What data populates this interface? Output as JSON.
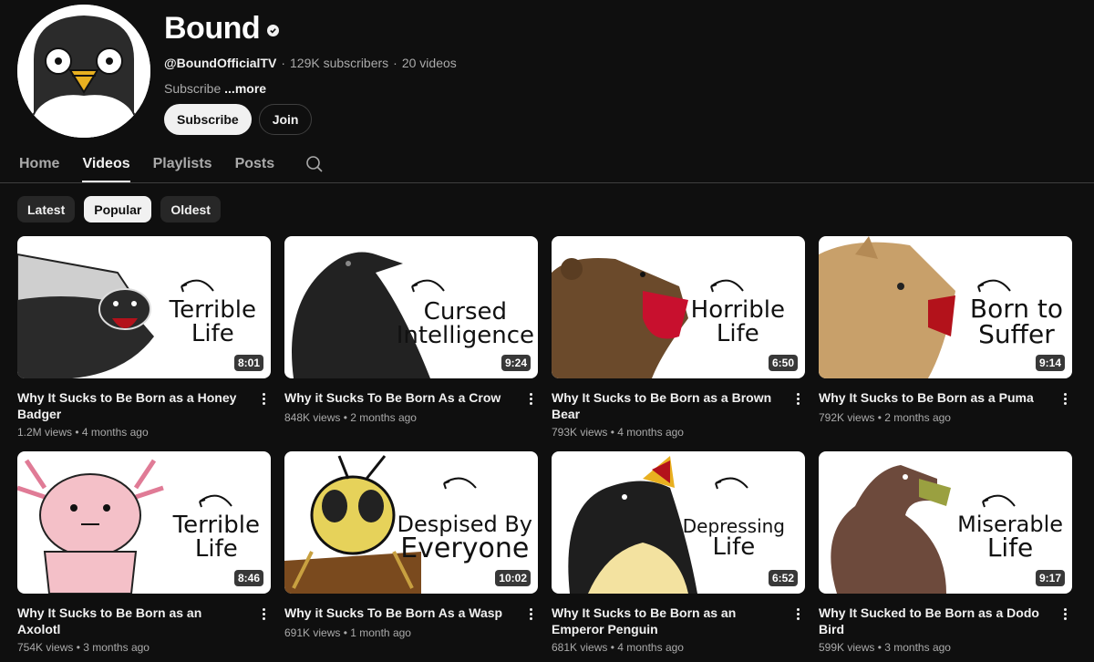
{
  "channel": {
    "name": "Bound",
    "handle": "@BoundOfficialTV",
    "subscribers": "129K subscribers",
    "videos_count": "20 videos",
    "separator": "·",
    "description": "Subscribe",
    "more_label": "...more",
    "subscribe_label": "Subscribe",
    "join_label": "Join"
  },
  "tabs": [
    {
      "label": "Home",
      "active": false
    },
    {
      "label": "Videos",
      "active": true
    },
    {
      "label": "Playlists",
      "active": false
    },
    {
      "label": "Posts",
      "active": false
    }
  ],
  "chips": [
    {
      "label": "Latest",
      "selected": false
    },
    {
      "label": "Popular",
      "selected": true
    },
    {
      "label": "Oldest",
      "selected": false
    }
  ],
  "videos": [
    {
      "title": "Why It Sucks to Be Born as a Honey Badger",
      "views": "1.2M views",
      "age": "4 months ago",
      "duration": "8:01",
      "thumb_line1": "Terrible",
      "thumb_line2": "Life",
      "animal": "honey-badger"
    },
    {
      "title": "Why it Sucks To Be Born As a Crow",
      "views": "848K views",
      "age": "2 months ago",
      "duration": "9:24",
      "thumb_line1": "Cursed",
      "thumb_line2": "Intelligence",
      "animal": "crow"
    },
    {
      "title": "Why It Sucks to Be Born as a Brown Bear",
      "views": "793K views",
      "age": "4 months ago",
      "duration": "6:50",
      "thumb_line1": "Horrible",
      "thumb_line2": "Life",
      "animal": "brown-bear"
    },
    {
      "title": "Why It Sucks to Be Born as a Puma",
      "views": "792K views",
      "age": "2 months ago",
      "duration": "9:14",
      "thumb_line1": "Born to",
      "thumb_line2": "Suffer",
      "animal": "puma"
    },
    {
      "title": "Why It Sucks to Be Born as an Axolotl",
      "views": "754K views",
      "age": "3 months ago",
      "duration": "8:46",
      "thumb_line1": "Terrible",
      "thumb_line2": "Life",
      "animal": "axolotl"
    },
    {
      "title": "Why it Sucks To Be Born As a Wasp",
      "views": "691K views",
      "age": "1 month ago",
      "duration": "10:02",
      "thumb_line1": "Despised By",
      "thumb_line2": "Everyone",
      "animal": "wasp"
    },
    {
      "title": "Why It Sucks to Be Born as an Emperor Penguin",
      "views": "681K views",
      "age": "4 months ago",
      "duration": "6:52",
      "thumb_line1": "Depressing",
      "thumb_line2": "Life",
      "animal": "emperor-penguin"
    },
    {
      "title": "Why It Sucked to Be Born as a Dodo Bird",
      "views": "599K views",
      "age": "3 months ago",
      "duration": "9:17",
      "thumb_line1": "Miserable",
      "thumb_line2": "Life",
      "animal": "dodo-bird"
    }
  ]
}
